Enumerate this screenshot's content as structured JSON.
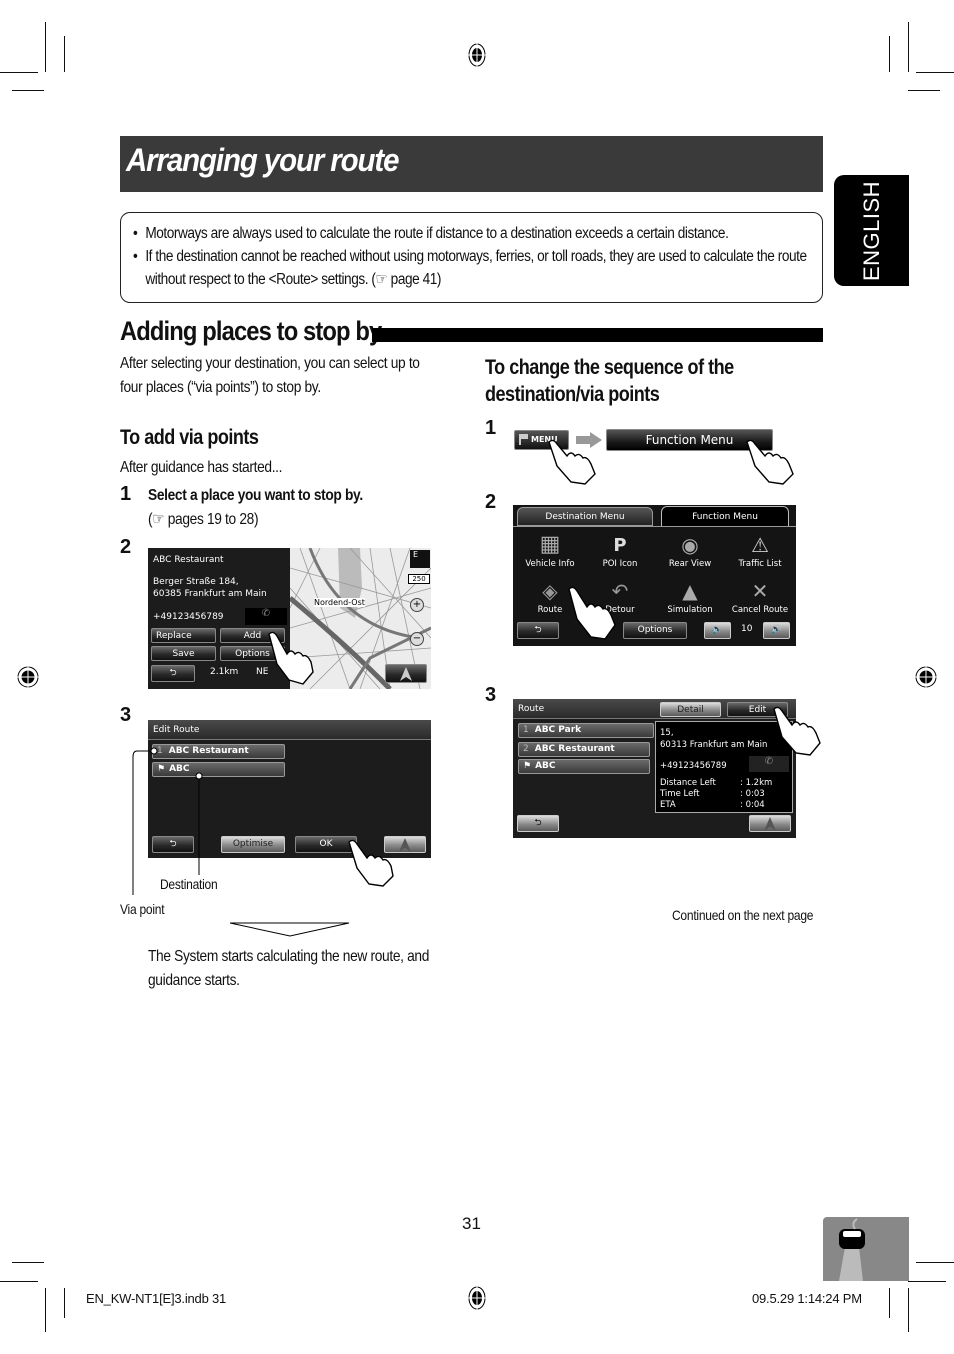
{
  "page": {
    "title": "Arranging your route",
    "language_tab": "ENGLISH",
    "page_number": "31",
    "continued_note": "Continued on the next page"
  },
  "notes": [
    "Motorways are always used to calculate the route if distance to a destination exceeds a certain distance.",
    "If the destination cannot be reached without using motorways, ferries, or toll roads, they are used to calculate the route without respect to the <Route> settings. (☞ page 41)"
  ],
  "section": {
    "title": "Adding places to stop by",
    "intro": [
      "After selecting your destination, you can select up to",
      "four places (“via points”) to stop by."
    ]
  },
  "add_via": {
    "title": "To add via points",
    "precondition": "After guidance has started...",
    "steps": [
      {
        "num": "1",
        "text": "Select a place you want to stop by.",
        "ref": "(☞ pages 19 to 28)"
      },
      {
        "num": "2"
      },
      {
        "num": "3"
      }
    ],
    "screen2": {
      "place_name": "ABC Restaurant",
      "address_line1": "Berger Straße 184,",
      "address_line2": "60385 Frankfurt am Main",
      "phone": "+49123456789",
      "replace_label": "Replace",
      "add_label": "Add",
      "save_label": "Save",
      "options_label": "Options",
      "distance": "2.1km",
      "heading": "NE",
      "map_label": "Nordend-Ost",
      "scale": "250",
      "compass": "E"
    },
    "screen3": {
      "title": "Edit Route",
      "items": [
        {
          "marker": "1",
          "label": "ABC Restaurant"
        },
        {
          "marker": "flag",
          "label": "ABC"
        }
      ],
      "optimise_label": "Optimise",
      "ok_label": "OK"
    },
    "callout_via": "Via point",
    "callout_destination": "Destination",
    "result": [
      "The System starts calculating the new route, and",
      "guidance starts."
    ]
  },
  "change_seq": {
    "title_lines": [
      "To change the sequence of the",
      "destination/via points"
    ],
    "steps": [
      {
        "num": "1"
      },
      {
        "num": "2"
      },
      {
        "num": "3"
      }
    ],
    "step1": {
      "menu_label": "MENU",
      "function_menu_label": "Function Menu"
    },
    "screen2": {
      "tabs": [
        "Destination Menu",
        "Function Menu"
      ],
      "icons": [
        "Vehicle Info",
        "POI Icon",
        "Rear View",
        "Traffic List",
        "Route",
        "Detour",
        "Simulation",
        "Cancel Route"
      ],
      "options_label": "Options",
      "volume": "10"
    },
    "screen3": {
      "title": "Route",
      "detail_label": "Detail",
      "edit_label": "Edit",
      "items": [
        {
          "marker": "1",
          "label": "ABC Park"
        },
        {
          "marker": "2",
          "label": "ABC Restaurant"
        },
        {
          "marker": "flag",
          "label": "ABC"
        }
      ],
      "address_line1": "15,",
      "address_line2": "60313 Frankfurt am Main",
      "phone": "+49123456789",
      "info": [
        {
          "label": "Distance Left",
          "value": ": 1.2km"
        },
        {
          "label": "Time Left",
          "value": ": 0:03"
        },
        {
          "label": "ETA",
          "value": ": 0:04"
        }
      ]
    }
  },
  "footer": {
    "file": "EN_KW-NT1[E]3.indb   31",
    "timestamp": "09.5.29   1:14:24 PM"
  }
}
